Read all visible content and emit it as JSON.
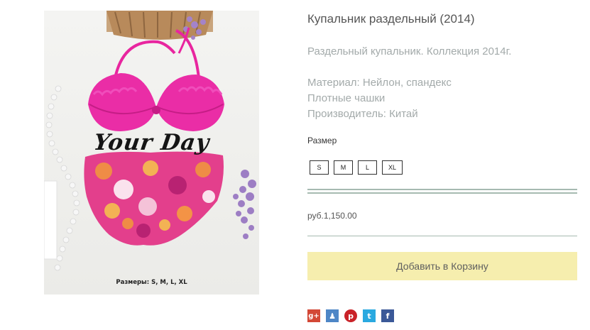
{
  "product": {
    "title": "Купальник раздельный (2014)",
    "description": [
      "Раздельный купальник. Коллекция 2014г.",
      "",
      "Материал: Нейлон, спандекс",
      "Плотные чашки",
      "Производитель: Китай"
    ],
    "image": {
      "brand_text": "Your Day",
      "sizes_caption": "Размеры: S, M, L, XL"
    },
    "size_label": "Размер",
    "sizes": [
      "S",
      "M",
      "L",
      "XL"
    ],
    "price": "руб.1,150.00",
    "add_to_cart_label": "Добавить в Корзину"
  },
  "share": {
    "icons": [
      "google-plus-icon",
      "bubble-icon",
      "pinterest-icon",
      "twitter-icon",
      "facebook-icon"
    ],
    "glyphs": [
      "g+",
      "♟",
      "p",
      "t",
      "f"
    ]
  },
  "colors": {
    "button_bg": "#f6eeae",
    "divider": "#a6bab1",
    "bikini_pink": "#e8269f",
    "google_plus": "#d34836",
    "pinterest": "#c92228",
    "twitter": "#2aa9e0",
    "facebook": "#3b5998"
  }
}
